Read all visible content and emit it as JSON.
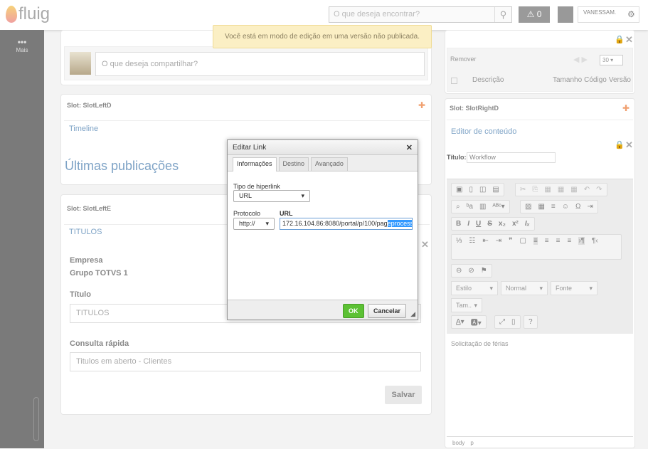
{
  "header": {
    "logo": "fluig",
    "search_placeholder": "O que deseja encontrar?",
    "alert_count": "0",
    "user_name": "VANESSAM."
  },
  "sidebar": {
    "more_label": "Mais"
  },
  "notice": "Você está em modo de edição em uma versão não publicada.",
  "left": {
    "share_placeholder": "O que deseja compartilhar?",
    "slot_d": "Slot: SlotLeftD",
    "timeline": "Timeline",
    "latest": "Últimas publicações",
    "slot_e": "Slot: SlotLeftE",
    "titulos": "TITULOS",
    "empresa_label": "Empresa",
    "empresa_value": "Grupo TOTVS 1",
    "titulo_label": "Título",
    "titulo_value": "TITULOS",
    "consulta_label": "Consulta rápida",
    "consulta_value": "Titulos em aberto - Clientes",
    "save": "Salvar"
  },
  "right": {
    "remove": "Remover",
    "page_size": "30",
    "columns": [
      "Descrição",
      "Tamanho",
      "Código",
      "Versão"
    ],
    "slot_d": "Slot: SlotRightD",
    "editor_link": "Editor de conteúdo",
    "title_label": "Título:",
    "title_value": "Workflow",
    "combo_style": "Estilo",
    "combo_format": "Normal",
    "combo_font": "Fonte",
    "combo_size": "Tam..",
    "content": "Solicitação de férias",
    "status_path": [
      "body",
      "p"
    ]
  },
  "dialog": {
    "title": "Editar Link",
    "tabs": [
      "Informações",
      "Destino",
      "Avançado"
    ],
    "link_type_label": "Tipo de hiperlink",
    "link_type": "URL",
    "protocol_label": "Protocolo",
    "protocol": "http://",
    "url_label": "URL",
    "url_value": "172.16.104.86:8080/portal/p/100/pag",
    "url_selected": "eprocess",
    "ok": "OK",
    "cancel": "Cancelar"
  }
}
